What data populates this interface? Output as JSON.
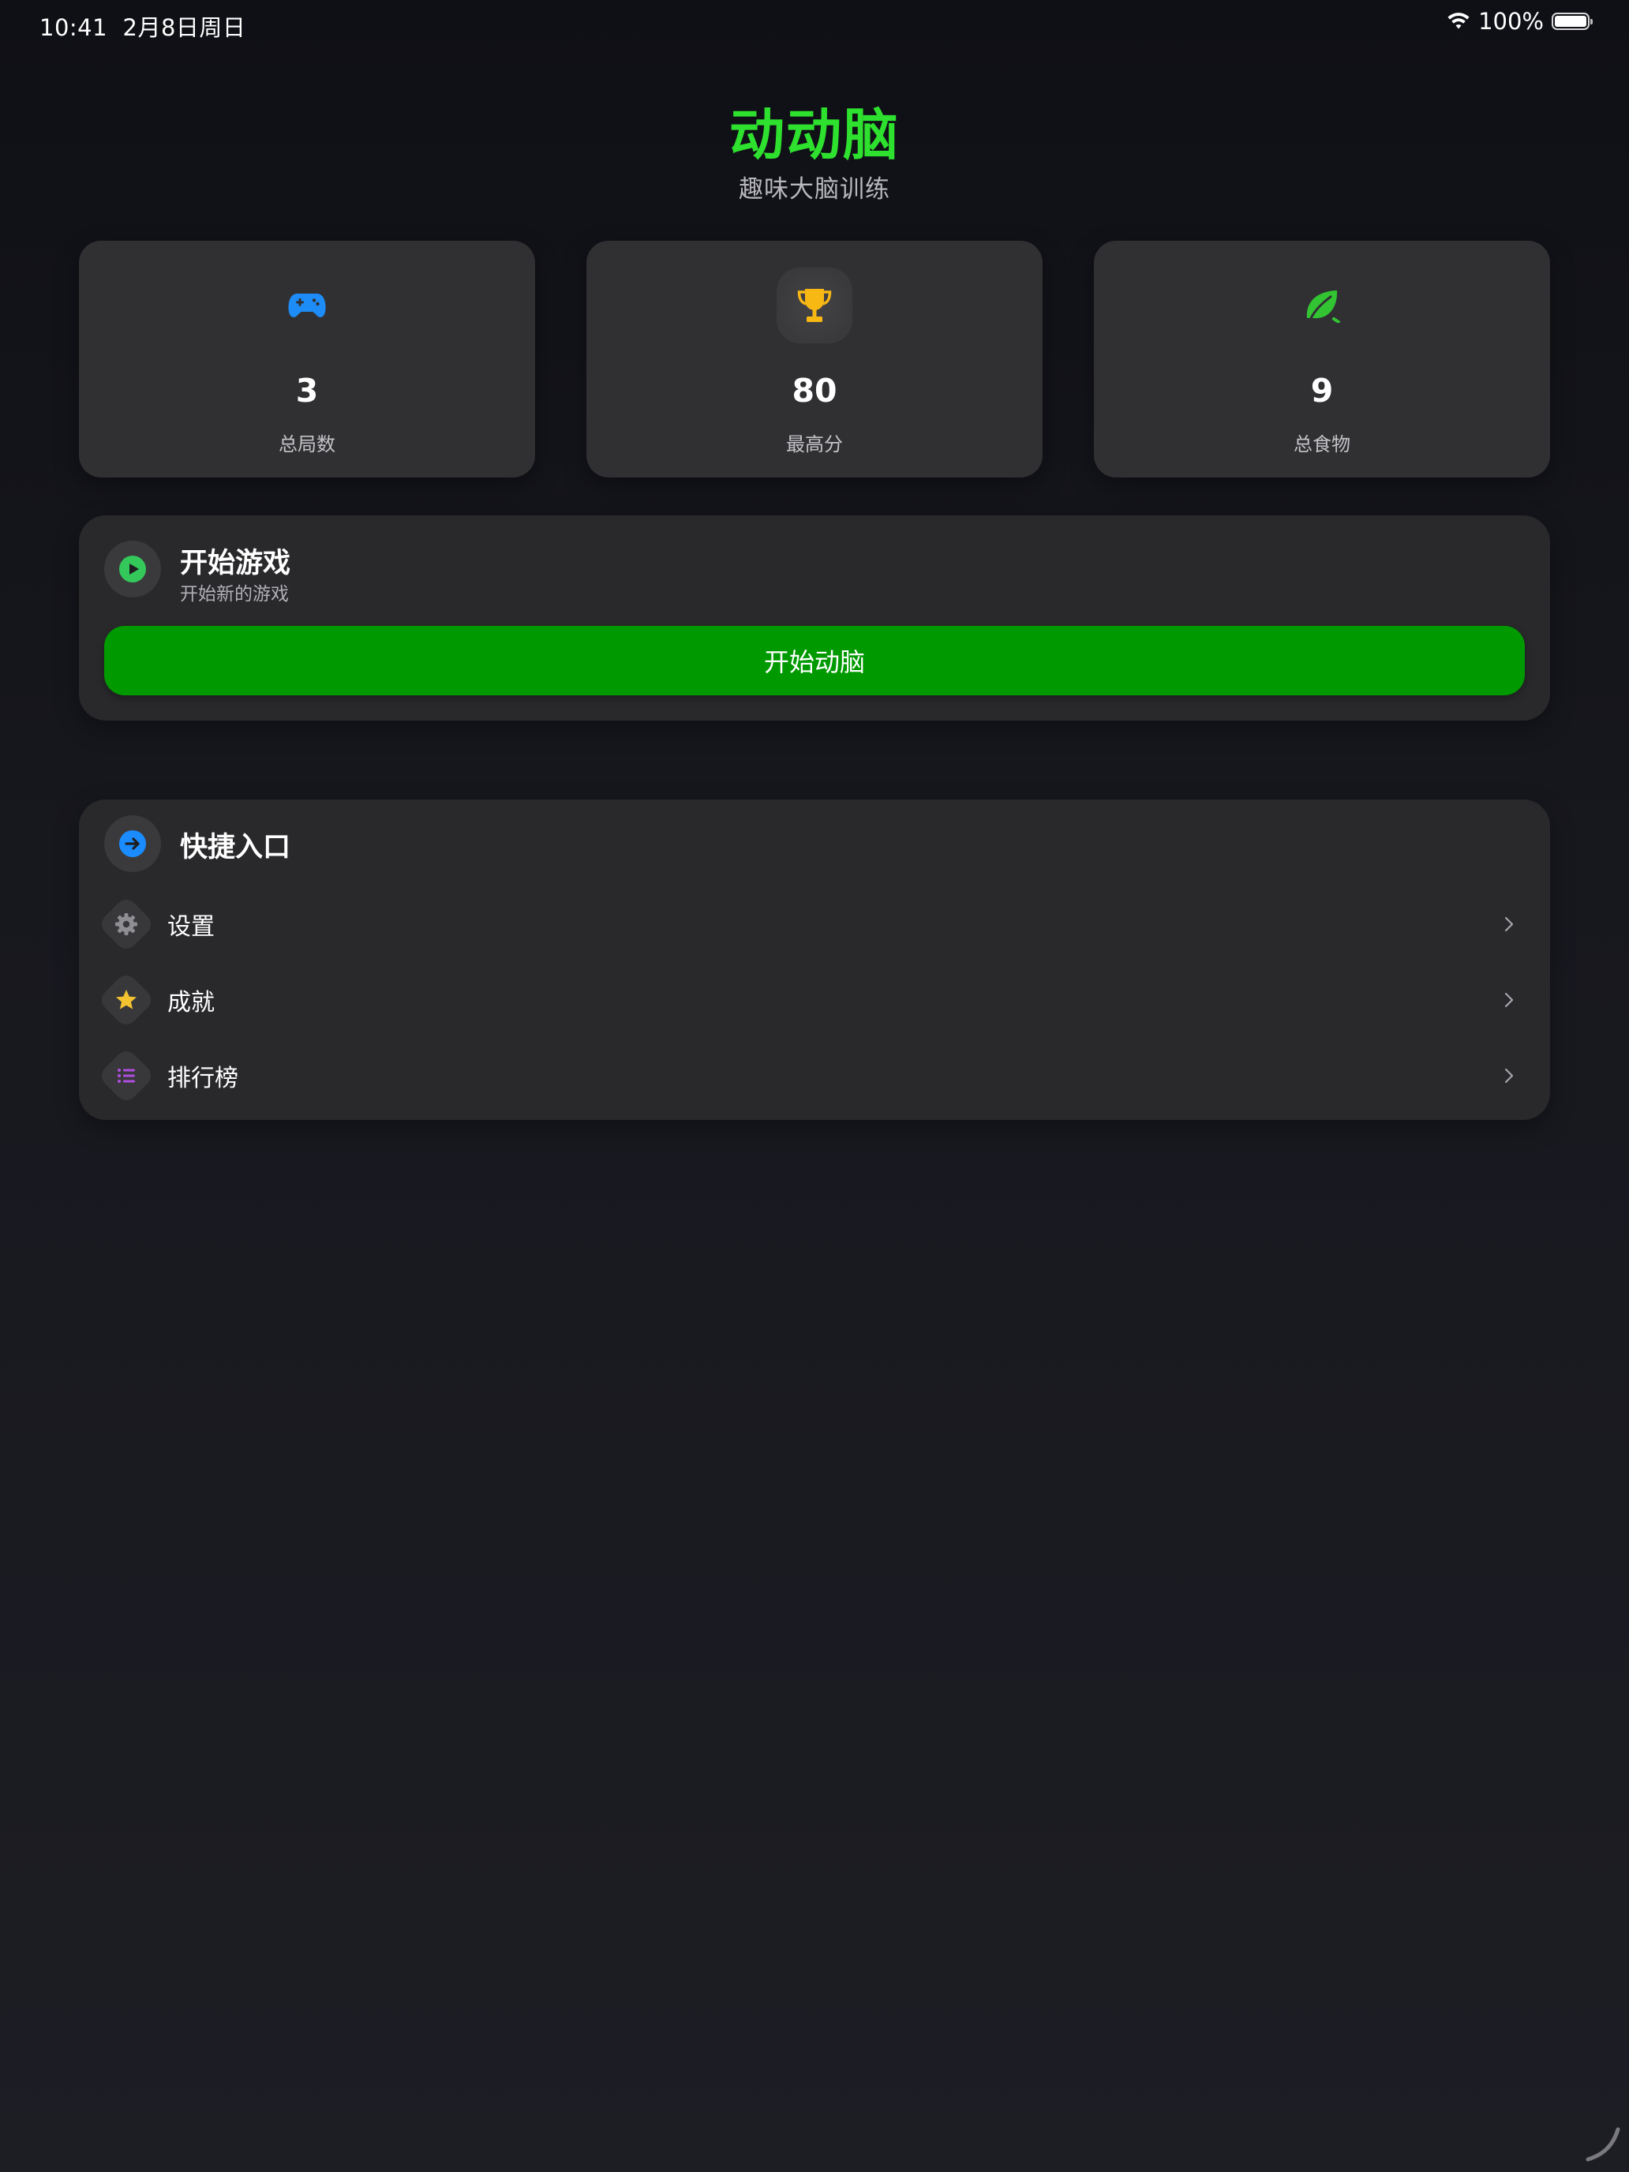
{
  "status_bar": {
    "time": "10:41",
    "date": "2月8日周日",
    "battery_percent": "100%",
    "battery_level": 1.0
  },
  "header": {
    "title": "动动脑",
    "subtitle": "趣味大脑训练"
  },
  "stats": [
    {
      "icon": "gamepad-icon",
      "value": "3",
      "label": "总局数",
      "color": "#1e8cf7"
    },
    {
      "icon": "trophy-icon",
      "value": "80",
      "label": "最高分",
      "color": "#f8b814"
    },
    {
      "icon": "leaf-icon",
      "value": "9",
      "label": "总食物",
      "color": "#33c433"
    }
  ],
  "start_game": {
    "title": "开始游戏",
    "subtitle": "开始新的游戏",
    "button_label": "开始动脑",
    "icon": "play-icon",
    "icon_color": "#34c759"
  },
  "quick_access": {
    "title": "快捷入口",
    "icon": "arrow-right-circle-icon",
    "icon_color": "#1a8cff",
    "items": [
      {
        "label": "设置",
        "icon": "gear-icon",
        "color": "#8e8e93"
      },
      {
        "label": "成就",
        "icon": "star-icon",
        "color": "#f2c230"
      },
      {
        "label": "排行榜",
        "icon": "list-icon",
        "color": "#b04ee0"
      }
    ]
  },
  "colors": {
    "accent_green": "#2ee12e",
    "button_green": "#009a00",
    "card_bg": "#303033",
    "panel_bg": "#29292c"
  }
}
